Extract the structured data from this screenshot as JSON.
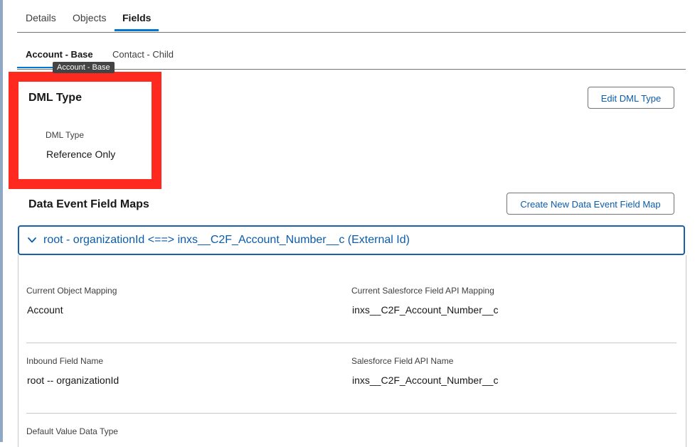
{
  "primary_tabs": [
    {
      "label": "Details"
    },
    {
      "label": "Objects"
    },
    {
      "label": "Fields"
    }
  ],
  "secondary_tabs": [
    {
      "label": "Account - Base"
    },
    {
      "label": "Contact - Child"
    }
  ],
  "tooltip": "Account - Base",
  "dml": {
    "title": "DML Type",
    "field_label": "DML Type",
    "field_value": "Reference Only",
    "edit_button": "Edit DML Type"
  },
  "field_maps": {
    "title": "Data Event Field Maps",
    "create_button": "Create New Data Event Field Map",
    "accordion_title": "root - organizationId <==> inxs__C2F_Account_Number__c (External Id)",
    "fields": {
      "current_object_mapping": {
        "label": "Current Object Mapping",
        "value": "Account"
      },
      "current_sf_field_api_mapping": {
        "label": "Current Salesforce Field API Mapping",
        "value": "inxs__C2F_Account_Number__c"
      },
      "inbound_field_name": {
        "label": "Inbound Field Name",
        "value": "root -- organizationId"
      },
      "sf_field_api_name": {
        "label": "Salesforce Field API Name",
        "value": "inxs__C2F_Account_Number__c"
      },
      "default_value_data_type": {
        "label": "Default Value Data Type"
      }
    }
  },
  "colors": {
    "accent": "#0176d3",
    "link": "#0b5cab",
    "highlight": "#ff2a1f"
  }
}
